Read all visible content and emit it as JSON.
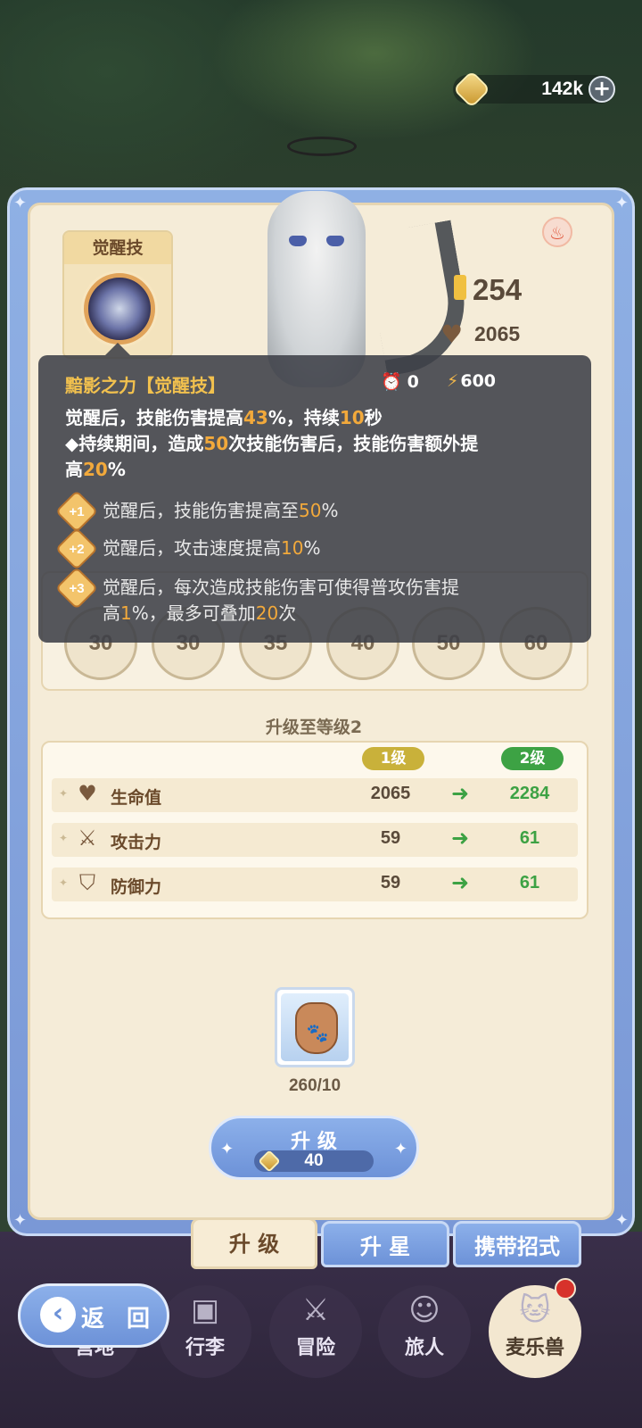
{
  "currency": {
    "amount": "142k",
    "coin_icon": "gold-coin-icon",
    "add_icon": "plus-icon"
  },
  "skill_card": {
    "title": "觉醒技",
    "icon": "shadow-skill-icon"
  },
  "pet": {
    "power": "254",
    "hp": "2065",
    "element_icon": "fire-icon"
  },
  "tooltip": {
    "title": "黯影之力【觉醒技】",
    "cooldown": "0",
    "energy": "600",
    "desc_line1": [
      {
        "t": "觉醒后，技能伤害提高"
      },
      {
        "t": "43",
        "hl": true
      },
      {
        "t": "%，持续"
      },
      {
        "t": "10",
        "hl": true
      },
      {
        "t": "秒"
      }
    ],
    "desc_line2": [
      {
        "t": "◆持续期间，造成"
      },
      {
        "t": "50",
        "hl": true
      },
      {
        "t": "次技能伤害后，技能伤害额外提"
      }
    ],
    "desc_line3": [
      {
        "t": "高"
      },
      {
        "t": "20",
        "hl": true
      },
      {
        "t": "%"
      }
    ],
    "bonuses": [
      {
        "badge": "+1",
        "parts": [
          {
            "t": "觉醒后，技能伤害提高至"
          },
          {
            "t": "50",
            "hl": true
          },
          {
            "t": "%"
          }
        ]
      },
      {
        "badge": "+2",
        "parts": [
          {
            "t": "觉醒后，攻击速度提高"
          },
          {
            "t": "10",
            "hl": true
          },
          {
            "t": "%"
          }
        ]
      },
      {
        "badge": "+3",
        "parts": [
          {
            "t": "觉醒后，每次造成技能伤害可使得普攻伤害提"
          }
        ],
        "parts2": [
          {
            "t": "高"
          },
          {
            "t": "1",
            "hl": true
          },
          {
            "t": "%，最多可叠加"
          },
          {
            "t": "20",
            "hl": true
          },
          {
            "t": "次"
          }
        ]
      }
    ]
  },
  "skill_slots": [
    "30",
    "30",
    "35",
    "40",
    "50",
    "60"
  ],
  "upgrade": {
    "title": "升级至等级2",
    "level_current": "1级",
    "level_next": "2级",
    "stats": [
      {
        "name": "生命值",
        "icon": "heart-icon",
        "glyph": "♥",
        "current": "2065",
        "next": "2284"
      },
      {
        "name": "攻击力",
        "icon": "crossed-swords-icon",
        "glyph": "⚔",
        "current": "59",
        "next": "61"
      },
      {
        "name": "防御力",
        "icon": "shield-icon",
        "glyph": "⛉",
        "current": "59",
        "next": "61"
      }
    ],
    "material": {
      "icon": "food-sack-icon",
      "count": "260/10"
    },
    "button_label": "升 级",
    "cost": "40"
  },
  "tabs": [
    "升 级",
    "升 星",
    "携带招式"
  ],
  "nav": [
    "营地",
    "行李",
    "冒险",
    "旅人",
    "麦乐兽"
  ],
  "back_label": "返 回",
  "colors": {
    "highlight": "#f2a93b",
    "green": "#3da244",
    "title_gold": "#f2c14e",
    "panel_blue": "#7a98d6"
  }
}
